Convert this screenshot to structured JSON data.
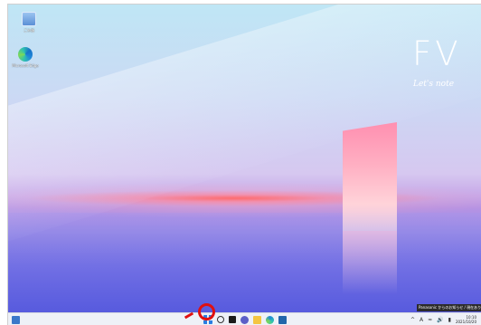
{
  "desktop": {
    "icons": [
      {
        "label": "ごみ箱",
        "icon": "recycle-bin-icon"
      },
      {
        "label": "Microsoft Edge",
        "icon": "edge-icon"
      }
    ],
    "logo": {
      "big": "FV",
      "small": "Let's note"
    }
  },
  "notification": {
    "text": "Panasonic からのお知らせ / 現在ありません"
  },
  "taskbar": {
    "items": [
      "start-button",
      "search-button",
      "task-view-button",
      "chat-button",
      "file-explorer-button",
      "edge-button",
      "store-button"
    ],
    "tray": {
      "chevron": "^",
      "ime": "A",
      "time": "10:10",
      "date": "2021/10/20"
    }
  },
  "annotation": {
    "highlight_color": "#e01010"
  }
}
